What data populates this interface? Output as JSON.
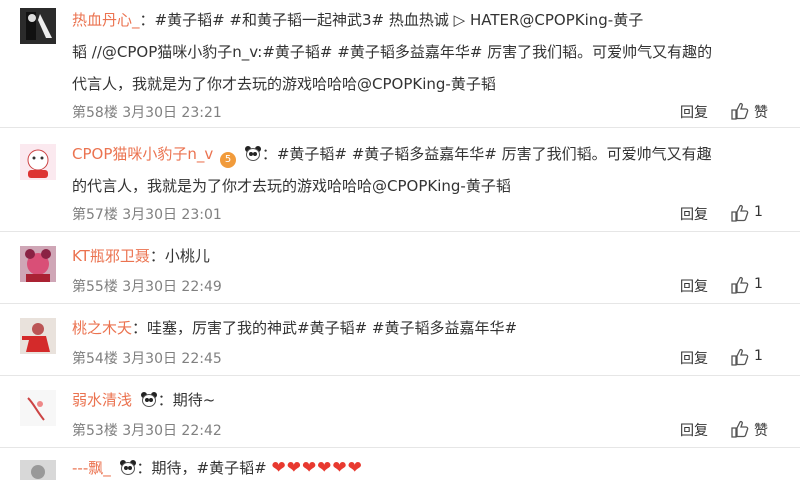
{
  "comments": [
    {
      "user": "热血丹心_",
      "line1_rest": "：#黄子韬# #和黄子韬一起神武3# 热血热诚 ▷ HATER@CPOPKing-黄子",
      "line2": "韬 //@CPOP猫咪小豹子n_v:#黄子韬# #黄子韬多益嘉年华# 厉害了我们韬。可爱帅气又有趣的",
      "line3": "代言人，我就是为了你才去玩的游戏哈哈哈@CPOPKing-黄子韬",
      "floor": "第58楼 3月30日 23:21",
      "reply": "回复",
      "like": "赞",
      "avatar_icon": "avatar-dark-icon"
    },
    {
      "user": "CPOP猫咪小豹子n_v",
      "badge": "5",
      "line1_rest": "：#黄子韬# #黄子韬多益嘉年华# 厉害了我们韬。可爱帅气又有趣",
      "line2": "的代言人，我就是为了你才去玩的游戏哈哈哈@CPOPKing-黄子韬",
      "floor": "第57楼 3月30日 23:01",
      "reply": "回复",
      "like_count": "1",
      "avatar_icon": "avatar-cartoon-icon"
    },
    {
      "user": "KT瓶邪卫聂",
      "line1_rest": "：小桃儿",
      "floor": "第55楼 3月30日 22:49",
      "reply": "回复",
      "like_count": "1",
      "avatar_icon": "avatar-pink-icon"
    },
    {
      "user": "桃之木夭",
      "line1_rest": "：哇塞，厉害了我的神武#黄子韬# #黄子韬多益嘉年华#",
      "floor": "第54楼 3月30日 22:45",
      "reply": "回复",
      "like_count": "1",
      "avatar_icon": "avatar-red-icon"
    },
    {
      "user": "弱水清浅",
      "line1_rest": "：期待~",
      "floor": "第53楼 3月30日 22:42",
      "reply": "回复",
      "like": "赞",
      "avatar_icon": "avatar-sketch-icon"
    },
    {
      "user": "---飘_",
      "line1_rest": "：期待，#黄子韬#",
      "hearts": "❤❤❤❤❤❤",
      "avatar_icon": "avatar-grey-icon"
    }
  ],
  "colors": {
    "link": "#eb7350",
    "text": "#333333",
    "meta": "#808080"
  }
}
